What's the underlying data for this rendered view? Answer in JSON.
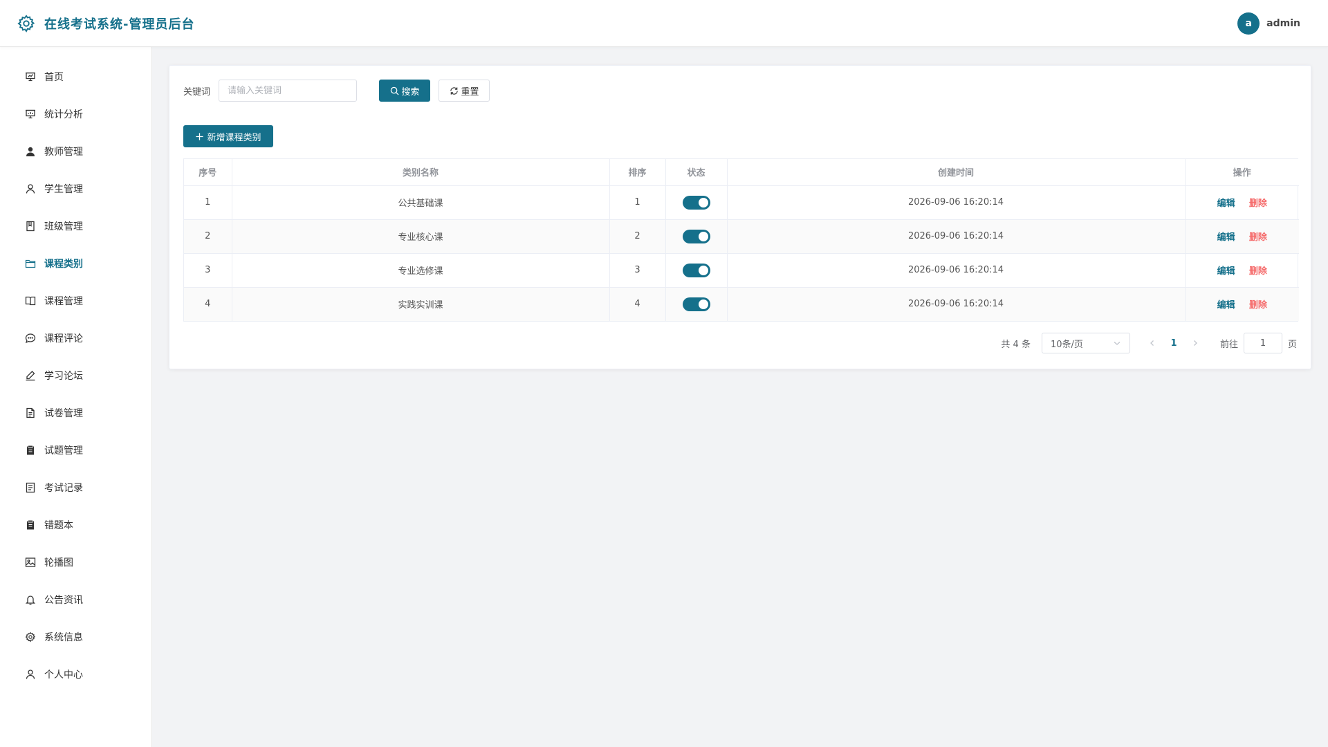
{
  "header": {
    "title": "在线考试系统-管理员后台",
    "avatar_letter": "a",
    "username": "admin"
  },
  "sidebar": {
    "items": [
      {
        "label": "首页",
        "icon": "presentation-icon",
        "active": false
      },
      {
        "label": "统计分析",
        "icon": "presentation-chart-icon",
        "active": false
      },
      {
        "label": "教师管理",
        "icon": "user-filled-icon",
        "active": false
      },
      {
        "label": "学生管理",
        "icon": "user-icon",
        "active": false
      },
      {
        "label": "班级管理",
        "icon": "notebook-icon",
        "active": false
      },
      {
        "label": "课程类别",
        "icon": "folder-icon",
        "active": true
      },
      {
        "label": "课程管理",
        "icon": "book-open-icon",
        "active": false
      },
      {
        "label": "课程评论",
        "icon": "chat-icon",
        "active": false
      },
      {
        "label": "学习论坛",
        "icon": "edit-pen-icon",
        "active": false
      },
      {
        "label": "试卷管理",
        "icon": "document-icon",
        "active": false
      },
      {
        "label": "试题管理",
        "icon": "clipboard-filled-icon",
        "active": false
      },
      {
        "label": "考试记录",
        "icon": "tickets-icon",
        "active": false
      },
      {
        "label": "错题本",
        "icon": "clipboard-filled-icon",
        "active": false
      },
      {
        "label": "轮播图",
        "icon": "picture-icon",
        "active": false
      },
      {
        "label": "公告资讯",
        "icon": "bell-icon",
        "active": false
      },
      {
        "label": "系统信息",
        "icon": "gear-icon",
        "active": false
      },
      {
        "label": "个人中心",
        "icon": "user-icon",
        "active": false
      }
    ]
  },
  "search": {
    "label": "关键词",
    "placeholder": "请输入关键词",
    "value": "",
    "search_label": "搜索",
    "reset_label": "重置"
  },
  "toolbar": {
    "add_label": "新增课程类别"
  },
  "table": {
    "columns": [
      "序号",
      "类别名称",
      "排序",
      "状态",
      "创建时间",
      "操作"
    ],
    "rows": [
      {
        "index": "1",
        "name": "公共基础课",
        "sort": "1",
        "enabled": true,
        "created": "2026-09-06 16:20:14"
      },
      {
        "index": "2",
        "name": "专业核心课",
        "sort": "2",
        "enabled": true,
        "created": "2026-09-06 16:20:14"
      },
      {
        "index": "3",
        "name": "专业选修课",
        "sort": "3",
        "enabled": true,
        "created": "2026-09-06 16:20:14"
      },
      {
        "index": "4",
        "name": "实践实训课",
        "sort": "4",
        "enabled": true,
        "created": "2026-09-06 16:20:14"
      }
    ],
    "edit_label": "编辑",
    "delete_label": "删除"
  },
  "pagination": {
    "total_text": "共 4 条",
    "page_size": "10条/页",
    "current_page": "1",
    "goto_label": "前往",
    "goto_value": "1",
    "goto_suffix": "页"
  },
  "colors": {
    "primary": "#15708b",
    "danger": "#f56c6c"
  }
}
